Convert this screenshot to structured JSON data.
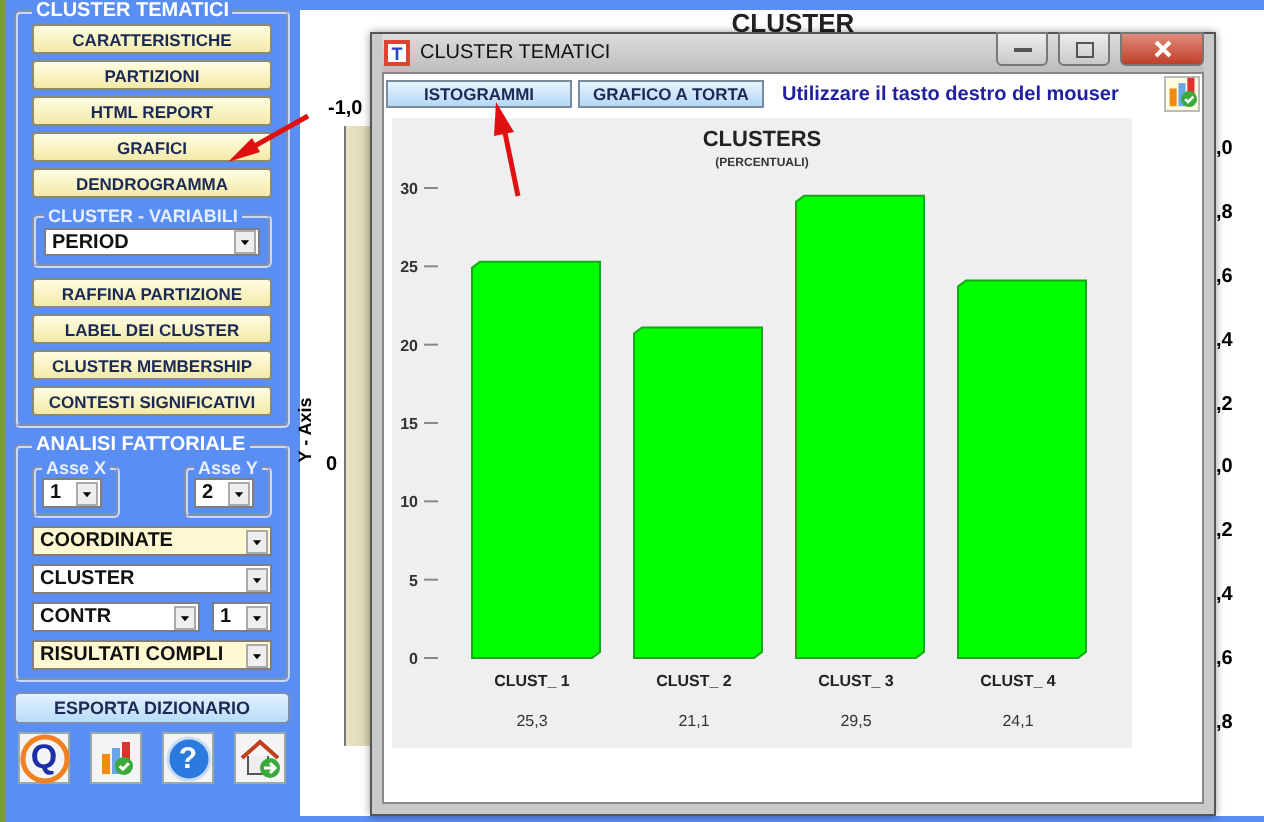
{
  "left_panel": {
    "cluster_group": {
      "title": "CLUSTER TEMATICI",
      "buttons_top": [
        "CARATTERISTICHE",
        "PARTIZIONI",
        "HTML REPORT",
        "GRAFICI",
        "DENDROGRAMMA"
      ],
      "variables": {
        "title": "CLUSTER - VARIABILI",
        "value": "PERIOD"
      },
      "buttons_bottom": [
        "RAFFINA PARTIZIONE",
        "LABEL DEI CLUSTER",
        "CLUSTER MEMBERSHIP",
        "CONTESTI SIGNIFICATIVI"
      ]
    },
    "factor_group": {
      "title": "ANALISI FATTORIALE",
      "axis_x": {
        "title": "Asse X",
        "value": "1"
      },
      "axis_y": {
        "title": "Asse Y",
        "value": "2"
      },
      "dropdown_rows": [
        [
          {
            "value": "COORDINATE",
            "highlighted": true
          }
        ],
        [
          {
            "value": "CLUSTER",
            "highlighted": false
          }
        ],
        [
          {
            "value": "CONTR",
            "highlighted": false
          },
          {
            "value": "1",
            "highlighted": false
          }
        ],
        [
          {
            "value": "RISULTATI COMPLI",
            "highlighted": true
          }
        ]
      ]
    },
    "export_button": "ESPORTA DIZIONARIO",
    "tool_icons": [
      {
        "kind": "q-logo",
        "label": "Q"
      },
      {
        "kind": "chart"
      },
      {
        "kind": "help",
        "label": "?"
      },
      {
        "kind": "home"
      }
    ]
  },
  "background_plot": {
    "title": "CLUSTER",
    "y_axis_title": "Y - Axis",
    "left_ticks": [
      "-1,0",
      "0"
    ],
    "right_ticks": [
      ",0",
      ",8",
      ",6",
      ",4",
      ",2",
      ",0",
      ",2",
      ",4",
      ",6",
      ",8"
    ]
  },
  "dialog": {
    "title": "CLUSTER TEMATICI",
    "app_icon_letter": "T",
    "toolbar_buttons": [
      "ISTOGRAMMI",
      "GRAFICO A TORTA"
    ],
    "hint": "Utilizzare il tasto destro del mouser",
    "chart_subtitle": "(PERCENTUALI)",
    "chart_data": {
      "type": "bar",
      "title": "CLUSTERS",
      "categories": [
        "CLUST_ 1",
        "CLUST_ 2",
        "CLUST_ 3",
        "CLUST_ 4"
      ],
      "series": [
        {
          "color": "#00ff00",
          "values": [
            25.3,
            21.1,
            29.5,
            24.1
          ]
        }
      ],
      "ylim": [
        0,
        30
      ],
      "yticks": [
        0,
        5,
        10,
        15,
        20,
        25,
        30
      ],
      "value_labels": [
        "25,3",
        "21,1",
        "29,5",
        "24,1"
      ]
    }
  }
}
